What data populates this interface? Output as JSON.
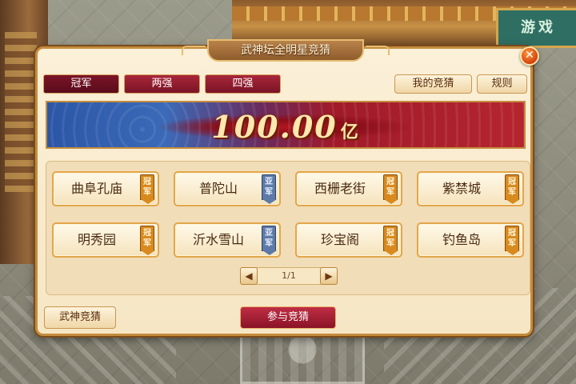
{
  "scene": {
    "signboard_text": "游戏"
  },
  "dialog": {
    "title": "武神坛全明星竞猜",
    "close_label": "✕",
    "tabs": [
      {
        "label": "冠军",
        "active": true
      },
      {
        "label": "两强",
        "active": false
      },
      {
        "label": "四强",
        "active": false
      }
    ],
    "my_bets_label": "我的竞猜",
    "rules_label": "规则",
    "prize": {
      "amount": "100.00",
      "unit": "亿"
    },
    "teams": [
      {
        "name": "曲阜孔庙",
        "badge": "冠军",
        "badge_type": "gold"
      },
      {
        "name": "普陀山",
        "badge": "亚军",
        "badge_type": "silver"
      },
      {
        "name": "西栅老街",
        "badge": "冠军",
        "badge_type": "gold"
      },
      {
        "name": "紫禁城",
        "badge": "冠军",
        "badge_type": "gold"
      },
      {
        "name": "明秀园",
        "badge": "冠军",
        "badge_type": "gold"
      },
      {
        "name": "沂水雪山",
        "badge": "亚军",
        "badge_type": "silver"
      },
      {
        "name": "珍宝阁",
        "badge": "冠军",
        "badge_type": "gold"
      },
      {
        "name": "钓鱼岛",
        "badge": "冠军",
        "badge_type": "gold"
      }
    ],
    "pager": {
      "prev": "◀",
      "next": "▶",
      "text": "1/1"
    },
    "bottom_left_label": "武神竞猜",
    "join_label": "参与竞猜"
  },
  "colors": {
    "tab_red": "#7b1427",
    "gold_badge": "#d88a1f",
    "silver_badge": "#5d7aa8",
    "prize_text": "#ffe7b0"
  }
}
